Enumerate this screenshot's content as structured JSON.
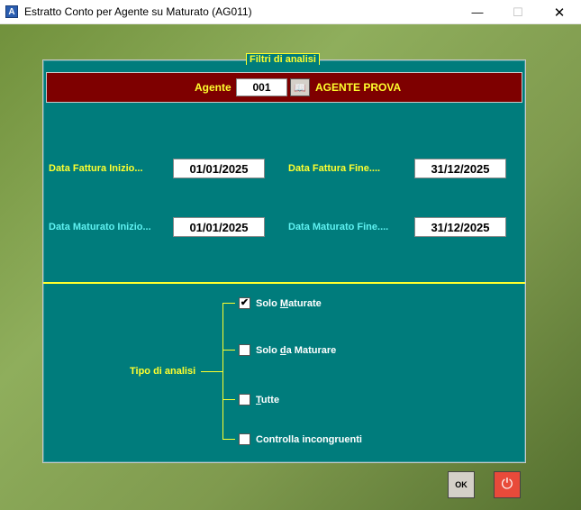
{
  "window": {
    "title": "Estratto Conto per Agente su Maturato (AG011)",
    "app_icon": "A",
    "minimize_icon": "—",
    "maximize_icon": "☐",
    "close_icon": "✕"
  },
  "panel": {
    "title": "Filtri di analisi"
  },
  "agent": {
    "label": "Agente",
    "code": "001",
    "lookup_icon": "📖",
    "name": "AGENTE PROVA"
  },
  "dates": {
    "fattura_inizio_label": "Data Fattura Inizio...",
    "fattura_inizio_value": "01/01/2025",
    "fattura_fine_label": "Data Fattura Fine....",
    "fattura_fine_value": "31/12/2025",
    "maturato_inizio_label": "Data Maturato Inizio...",
    "maturato_inizio_value": "01/01/2025",
    "maturato_fine_label": "Data Maturato Fine....",
    "maturato_fine_value": "31/12/2025"
  },
  "tipo": {
    "label": "Tipo di analisi",
    "options": [
      {
        "label": "Solo Maturate",
        "checked": true
      },
      {
        "label": "Solo da Maturare",
        "checked": false
      },
      {
        "label": "Tutte",
        "checked": false
      },
      {
        "label": "Controlla incongruenti",
        "checked": false
      }
    ]
  },
  "buttons": {
    "ok_label": "OK",
    "quit_icon": "⏻"
  },
  "colors": {
    "panel": "#007c7c",
    "agent_bar": "#7e0000",
    "accent_yellow": "#ffff2e",
    "accent_cyan": "#5ff2f2"
  }
}
